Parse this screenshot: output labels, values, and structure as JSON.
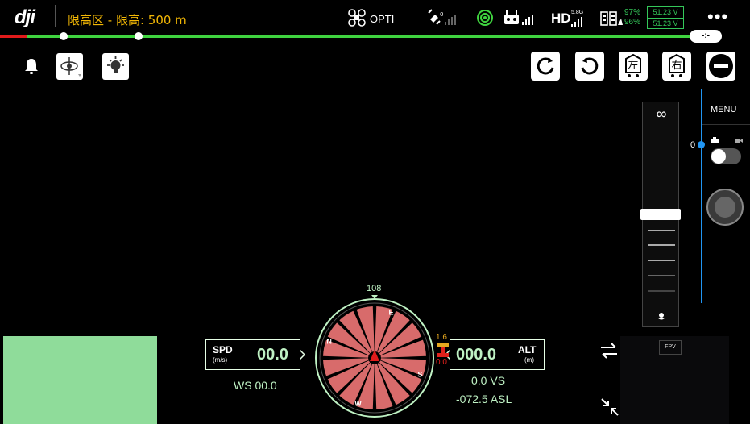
{
  "topbar": {
    "logo": "dji",
    "altitude_limit": "限高区 - 限高: 500 m",
    "flight_mode": "OPTI",
    "hd_label": "HD",
    "hd_band": "5.8G",
    "battery": {
      "percent_aircraft": "97%",
      "percent_rc": "96%",
      "voltage_1": "51.23 V",
      "voltage_2": "51.23 V"
    },
    "more_label": "•••",
    "line_end_label": "-:-"
  },
  "toolbar": {
    "left_button_label": "左",
    "right_button_label": "右"
  },
  "side_panel": {
    "menu_label": "MENU",
    "slider_value": "0",
    "gimbal_infinity": "∞"
  },
  "flight_data": {
    "speed_label": "SPD",
    "speed_unit": "(m/s)",
    "speed_value": "00.0",
    "wind_speed": "WS 00.0",
    "altitude_label": "ALT",
    "altitude_unit": "(m)",
    "altitude_value": "000.0",
    "vertical_speed": "0.0  VS",
    "asl": "-072.5 ASL",
    "heading": "108",
    "obstacle_top": "1.6",
    "obstacle_bottom": "0.0"
  },
  "fpv": {
    "label": "FPV"
  },
  "compass": {
    "letters": [
      "E",
      "S",
      "W",
      "N"
    ],
    "numbers": [
      "12",
      "15",
      "21",
      "24",
      "30",
      "33",
      "3",
      "6"
    ]
  },
  "colors": {
    "accent_green": "#3fd33f",
    "warning_yellow": "#f2b705",
    "menu_blue": "#2196f3",
    "text_green": "#bff2c4"
  }
}
